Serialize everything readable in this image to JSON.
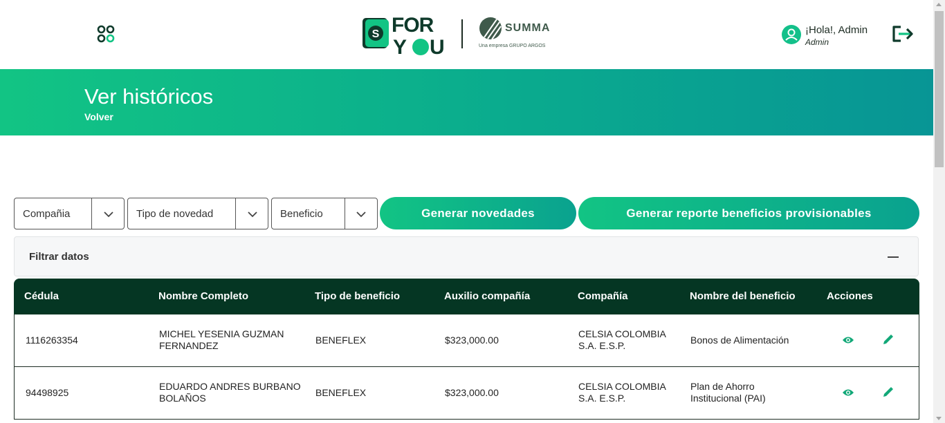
{
  "header": {
    "apps_icon": "apps-grid-icon",
    "brand_logo_text": "FOR YOU",
    "brand_logo_letter": "S",
    "partner_logo_text": "SUMMA",
    "partner_logo_subtext": "Una empresa  GRUPO ARGOS",
    "greeting": "¡Hola!, Admin",
    "role": "Admin",
    "logout_icon": "logout-icon"
  },
  "banner": {
    "title": "Ver históricos",
    "back_link": "Volver"
  },
  "filters": {
    "company_select": "Compañia",
    "type_select": "Tipo de novedad",
    "benefit_select": "Beneficio",
    "generate_button": "Generar novedades",
    "report_button": "Generar reporte beneficios provisionables",
    "filter_panel_title": "Filtrar datos"
  },
  "table": {
    "columns": [
      "Cédula",
      "Nombre Completo",
      "Tipo de beneficio",
      "Auxilio compañía",
      "Compañía",
      "Nombre del beneficio",
      "Acciones"
    ],
    "rows": [
      {
        "cedula": "1116263354",
        "nombre_l1": "MICHEL YESENIA GUZMAN",
        "nombre_l2": "FERNANDEZ",
        "tipo": "BENEFLEX",
        "auxilio": "$323,000.00",
        "compania_l1": "CELSIA COLOMBIA",
        "compania_l2": "S.A. E.S.P.",
        "beneficio_l1": "Bonos de Alimentación",
        "beneficio_l2": ""
      },
      {
        "cedula": "94498925",
        "nombre_l1": "EDUARDO ANDRES BURBANO",
        "nombre_l2": "BOLAÑOS",
        "tipo": "BENEFLEX",
        "auxilio": "$323,000.00",
        "compania_l1": "CELSIA COLOMBIA",
        "compania_l2": "S.A. E.S.P.",
        "beneficio_l1": "Plan de Ahorro",
        "beneficio_l2": "Institucional (PAI)"
      }
    ]
  },
  "colors": {
    "accent_green": "#12c484",
    "teal": "#089595",
    "table_header": "#053623"
  }
}
